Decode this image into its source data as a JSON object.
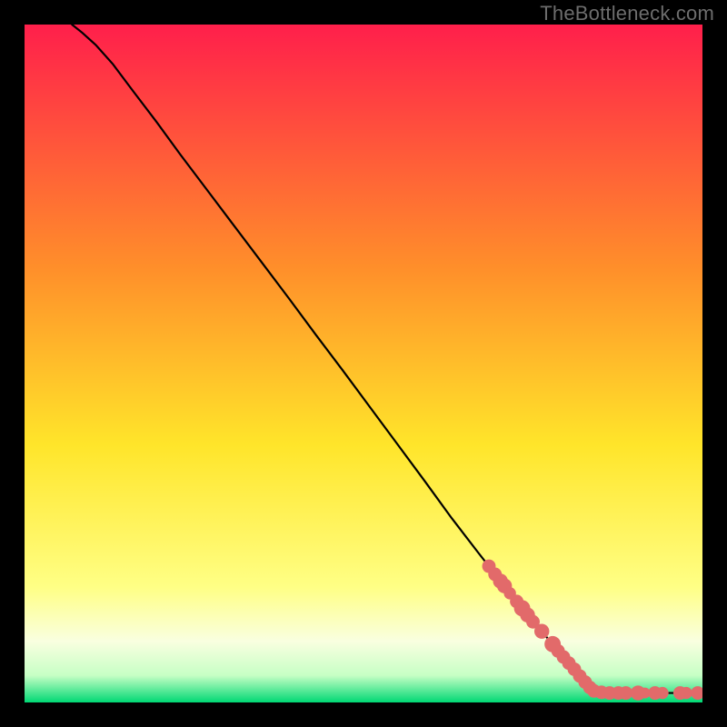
{
  "attribution": "TheBottleneck.com",
  "colors": {
    "gradient_top": "#ff1f4b",
    "gradient_mid_upper": "#ff8f2a",
    "gradient_mid": "#ffe52a",
    "gradient_mid_lower": "#ffff85",
    "gradient_lower_a": "#f9ffe0",
    "gradient_lower_b": "#c7ffc5",
    "gradient_bottom": "#00d874",
    "curve": "#000000",
    "marker_fill": "#e26a6a",
    "marker_stroke": "#e26a6a",
    "background": "#000000"
  },
  "chart_data": {
    "type": "line",
    "title": "",
    "xlabel": "",
    "ylabel": "",
    "xlim": [
      0,
      100
    ],
    "ylim": [
      0,
      100
    ],
    "grid": false,
    "legend": null,
    "curve_comment": "Main curve: starts at (7,100), slight convex bend near top, then nearly straight descent to about (84,1.5), then flat to (100,1.5). Values are normalized to 0–100 plot units.",
    "curve": [
      {
        "x": 7.0,
        "y": 100.0
      },
      {
        "x": 8.5,
        "y": 98.8
      },
      {
        "x": 10.5,
        "y": 97.0
      },
      {
        "x": 13.0,
        "y": 94.2
      },
      {
        "x": 16.0,
        "y": 90.2
      },
      {
        "x": 19.5,
        "y": 85.6
      },
      {
        "x": 23.0,
        "y": 80.8
      },
      {
        "x": 27.0,
        "y": 75.5
      },
      {
        "x": 31.0,
        "y": 70.2
      },
      {
        "x": 35.0,
        "y": 64.9
      },
      {
        "x": 39.0,
        "y": 59.6
      },
      {
        "x": 43.0,
        "y": 54.2
      },
      {
        "x": 47.0,
        "y": 48.9
      },
      {
        "x": 51.0,
        "y": 43.5
      },
      {
        "x": 55.0,
        "y": 38.1
      },
      {
        "x": 59.0,
        "y": 32.7
      },
      {
        "x": 63.0,
        "y": 27.2
      },
      {
        "x": 67.0,
        "y": 22.0
      },
      {
        "x": 71.0,
        "y": 16.9
      },
      {
        "x": 75.0,
        "y": 12.0
      },
      {
        "x": 79.0,
        "y": 7.3
      },
      {
        "x": 82.0,
        "y": 3.8
      },
      {
        "x": 84.0,
        "y": 1.6
      },
      {
        "x": 86.0,
        "y": 1.4
      },
      {
        "x": 90.0,
        "y": 1.4
      },
      {
        "x": 95.0,
        "y": 1.4
      },
      {
        "x": 100.0,
        "y": 1.4
      }
    ],
    "markers_comment": "Pink/red markers overplotted on the lower portion of the curve. Sizes in plot units (radius).",
    "markers": [
      {
        "x": 68.5,
        "y": 20.1,
        "r": 1.0
      },
      {
        "x": 69.4,
        "y": 18.9,
        "r": 1.0
      },
      {
        "x": 70.2,
        "y": 17.9,
        "r": 1.1
      },
      {
        "x": 70.8,
        "y": 17.2,
        "r": 1.1
      },
      {
        "x": 71.6,
        "y": 16.1,
        "r": 0.9
      },
      {
        "x": 72.6,
        "y": 14.9,
        "r": 1.0
      },
      {
        "x": 73.4,
        "y": 13.9,
        "r": 1.2
      },
      {
        "x": 74.2,
        "y": 12.9,
        "r": 1.1
      },
      {
        "x": 75.0,
        "y": 11.9,
        "r": 1.0
      },
      {
        "x": 76.3,
        "y": 10.5,
        "r": 1.1
      },
      {
        "x": 77.9,
        "y": 8.6,
        "r": 1.2
      },
      {
        "x": 78.7,
        "y": 7.6,
        "r": 1.0
      },
      {
        "x": 79.5,
        "y": 6.7,
        "r": 1.0
      },
      {
        "x": 80.3,
        "y": 5.8,
        "r": 1.0
      },
      {
        "x": 81.1,
        "y": 4.9,
        "r": 1.0
      },
      {
        "x": 81.9,
        "y": 3.9,
        "r": 1.0
      },
      {
        "x": 82.7,
        "y": 3.0,
        "r": 1.0
      },
      {
        "x": 83.4,
        "y": 2.2,
        "r": 1.0
      },
      {
        "x": 84.0,
        "y": 1.7,
        "r": 1.0
      },
      {
        "x": 85.1,
        "y": 1.5,
        "r": 1.0
      },
      {
        "x": 86.3,
        "y": 1.4,
        "r": 1.0
      },
      {
        "x": 87.6,
        "y": 1.4,
        "r": 1.0
      },
      {
        "x": 88.7,
        "y": 1.4,
        "r": 1.0
      },
      {
        "x": 90.5,
        "y": 1.4,
        "r": 1.1
      },
      {
        "x": 91.5,
        "y": 1.4,
        "r": 0.8
      },
      {
        "x": 93.0,
        "y": 1.4,
        "r": 1.0
      },
      {
        "x": 94.1,
        "y": 1.4,
        "r": 0.9
      },
      {
        "x": 96.7,
        "y": 1.4,
        "r": 1.0
      },
      {
        "x": 97.6,
        "y": 1.4,
        "r": 0.9
      },
      {
        "x": 99.3,
        "y": 1.4,
        "r": 1.0
      }
    ]
  }
}
